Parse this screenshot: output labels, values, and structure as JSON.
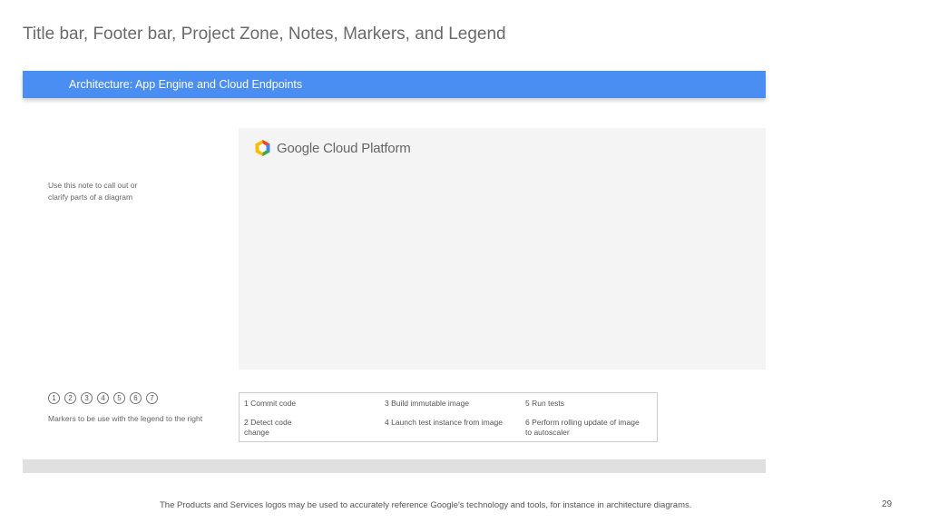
{
  "slide": {
    "title": "Title bar, Footer bar, Project Zone, Notes, Markers, and Legend",
    "page_number": "29"
  },
  "title_bar": {
    "text": "Architecture: App Engine and Cloud Endpoints",
    "color": "#4a8ef3"
  },
  "project_zone": {
    "logo_icon": "google-cloud-hexagon-icon",
    "logo_text": "Google Cloud Platform"
  },
  "note": {
    "text": "Use this note to call out or clarify parts of a diagram"
  },
  "markers": {
    "items": [
      "1",
      "2",
      "3",
      "4",
      "5",
      "6",
      "7"
    ],
    "note": "Markers to be use with the legend to the right"
  },
  "legend": {
    "items": [
      "1 Commit code",
      "2 Detect code change",
      "3 Build immutable image",
      "4 Launch test instance from image",
      "5 Run tests",
      "6 Perform rolling update of image\n to autoscaler"
    ]
  },
  "footer": {
    "disclaimer": "The Products and Services logos may be used to accurately reference Google's technology and tools, for instance in architecture diagrams."
  }
}
